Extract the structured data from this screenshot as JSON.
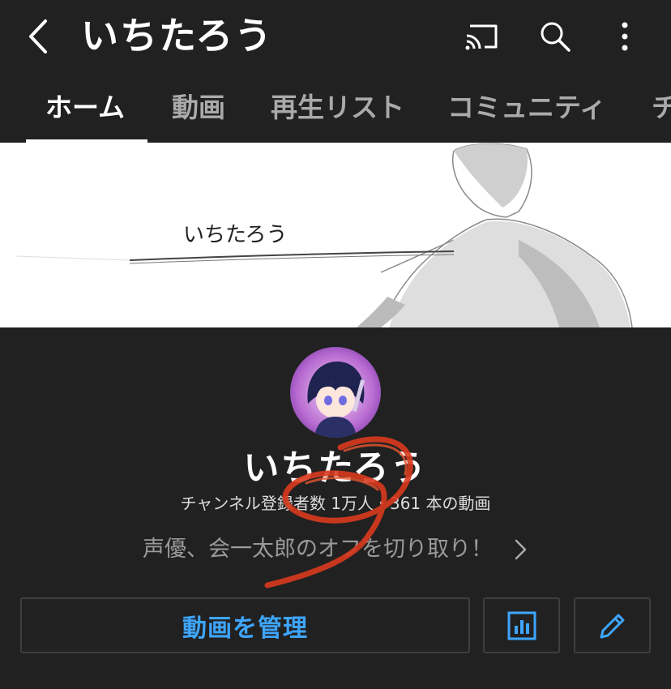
{
  "topbar": {
    "title": "いちたろう",
    "icons": [
      "back-icon",
      "cast-icon",
      "search-icon",
      "more-vert-icon"
    ]
  },
  "tabs": [
    {
      "label": "ホーム",
      "active": true
    },
    {
      "label": "動画",
      "active": false
    },
    {
      "label": "再生リスト",
      "active": false
    },
    {
      "label": "コミュニティ",
      "active": false
    },
    {
      "label": "チ",
      "active": false
    }
  ],
  "banner": {
    "text": "いちたろう"
  },
  "channel": {
    "name": "いちたろう",
    "stats": "チャンネル登録者数 1万人・361 本の動画",
    "description": "声優、会一太郎のオフを切り取り！"
  },
  "actions": {
    "manage_label": "動画を管理",
    "analytics_icon": "analytics-icon",
    "edit_icon": "pencil-icon"
  },
  "colors": {
    "background": "#212121",
    "accent": "#3ea6ff",
    "scribble": "#d83a1e"
  }
}
